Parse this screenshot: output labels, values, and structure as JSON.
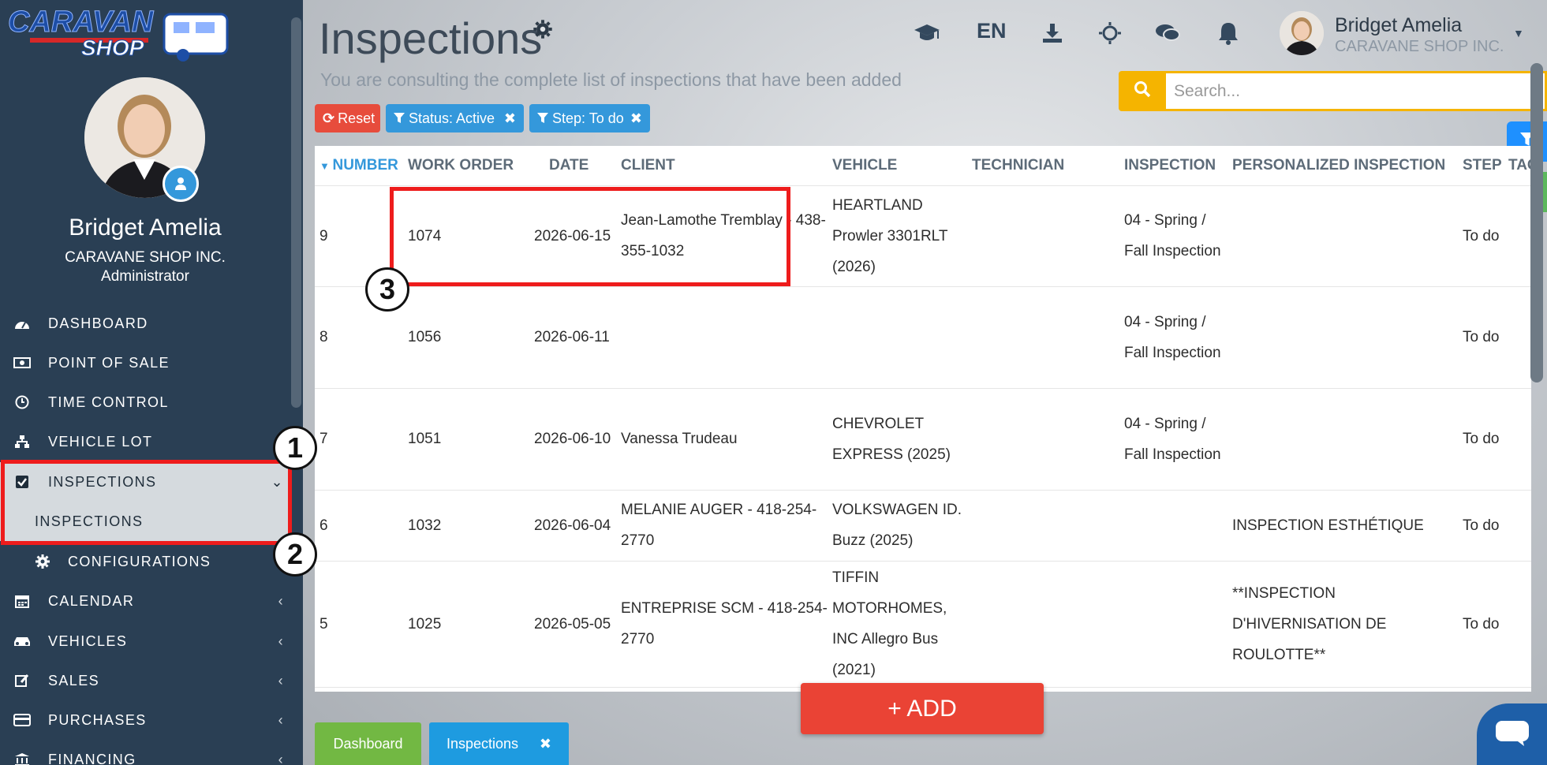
{
  "logo": {
    "text_top": "CARAVAN",
    "text_bottom": "SHOP"
  },
  "sidebar": {
    "user_name": "Bridget Amelia",
    "company": "CARAVANE SHOP INC.",
    "role": "Administrator",
    "menu": [
      {
        "label": "DASHBOARD",
        "icon": "dashboard-icon"
      },
      {
        "label": "POINT OF SALE",
        "icon": "money-icon"
      },
      {
        "label": "TIME CONTROL",
        "icon": "clock-icon"
      },
      {
        "label": "VEHICLE LOT",
        "icon": "sitemap-icon"
      },
      {
        "label": "INSPECTIONS",
        "icon": "checkbox-icon"
      },
      {
        "label": "CALENDAR",
        "icon": "calendar-icon"
      },
      {
        "label": "VEHICLES",
        "icon": "car-icon"
      },
      {
        "label": "SALES",
        "icon": "edit-icon"
      },
      {
        "label": "PURCHASES",
        "icon": "credit-card-icon"
      },
      {
        "label": "FINANCING",
        "icon": "bank-icon"
      }
    ],
    "sub_inspections": "INSPECTIONS",
    "sub_configurations": "CONFIGURATIONS"
  },
  "header": {
    "title": "Inspections",
    "subtitle": "You are consulting the complete list of inspections that have been added",
    "lang": "EN",
    "user_name": "Bridget Amelia",
    "user_company": "CARAVANE SHOP INC."
  },
  "search": {
    "placeholder": "Search..."
  },
  "filters": {
    "reset": "Reset",
    "status": "Status: Active",
    "step": "Step: To do"
  },
  "table": {
    "columns": [
      "NUMBER",
      "WORK ORDER",
      "DATE",
      "CLIENT",
      "VEHICLE",
      "TECHNICIAN",
      "INSPECTION",
      "PERSONALIZED INSPECTION",
      "STEP",
      "TAGS"
    ],
    "rows": [
      {
        "number": "9",
        "work_order": "1074",
        "date": "2026-06-15",
        "client": "Jean-Lamothe Tremblay - 438-355-1032",
        "vehicle": "HEARTLAND Prowler 3301RLT (2026)",
        "technician": "",
        "inspection": "04 - Spring / Fall Inspection",
        "personalized": "",
        "step": "To do"
      },
      {
        "number": "8",
        "work_order": "1056",
        "date": "2026-06-11",
        "client": "",
        "vehicle": "",
        "technician": "",
        "inspection": "04 - Spring / Fall Inspection",
        "personalized": "",
        "step": "To do"
      },
      {
        "number": "7",
        "work_order": "1051",
        "date": "2026-06-10",
        "client": "Vanessa Trudeau",
        "vehicle": "CHEVROLET EXPRESS (2025)",
        "technician": "",
        "inspection": "04 - Spring / Fall Inspection",
        "personalized": "",
        "step": "To do"
      },
      {
        "number": "6",
        "work_order": "1032",
        "date": "2026-06-04",
        "client": "MELANIE AUGER - 418-254-2770",
        "vehicle": "VOLKSWAGEN ID. Buzz (2025)",
        "technician": "",
        "inspection": "",
        "personalized": "INSPECTION ESTHÉTIQUE",
        "step": "To do"
      },
      {
        "number": "5",
        "work_order": "1025",
        "date": "2026-05-05",
        "client": "ENTREPRISE SCM - 418-254-2770",
        "vehicle": "TIFFIN MOTORHOMES, INC Allegro Bus (2021)",
        "technician": "",
        "inspection": "",
        "personalized": "**INSPECTION D'HIVERNISATION DE ROULOTTE**",
        "step": "To do"
      }
    ]
  },
  "annotations": [
    "1",
    "2",
    "3"
  ],
  "add_button": "+ ADD",
  "bottom_tabs": {
    "dashboard": "Dashboard",
    "inspections": "Inspections"
  },
  "colors": {
    "sidebar_bg": "#2a3f54",
    "accent_blue": "#3498db",
    "reset_red": "#e74c3c",
    "search_yellow": "#f5b400",
    "add_red": "#ea4335",
    "tab_green": "#72b843",
    "annotation_red": "#ee1c1c"
  }
}
